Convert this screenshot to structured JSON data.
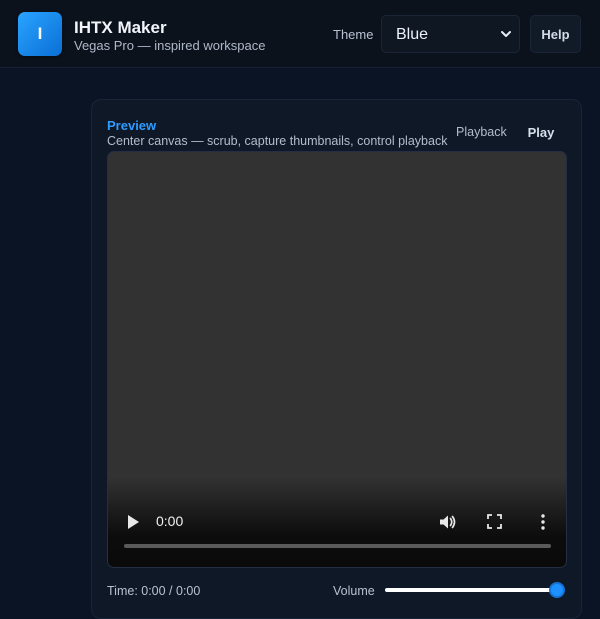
{
  "header": {
    "logo_letter": "I",
    "title": "IHTX Maker",
    "subtitle": "Vegas Pro — inspired workspace",
    "theme_label": "Theme",
    "theme_value": "Blue",
    "help_label": "Help"
  },
  "preview": {
    "title": "Preview",
    "subtitle": "Center canvas — scrub, capture thumbnails, control playback",
    "playback_tab": "Playback",
    "play_label": "Play",
    "video": {
      "current_time": "0:00",
      "progress": 0
    },
    "time_readout": "Time: 0:00 / 0:00",
    "volume_label": "Volume",
    "volume_level": 1.0
  },
  "colors": {
    "accent": "#2e9bff",
    "logo_gradient_start": "#2aa4ff",
    "logo_gradient_end": "#0a6fd6",
    "slider_thumb": "#1e90ff"
  },
  "icons": {
    "theme_dropdown": "chevron-down-icon",
    "video_play": "play-icon",
    "video_volume": "volume-icon",
    "video_fullscreen": "fullscreen-icon",
    "video_more": "more-vertical-icon"
  }
}
